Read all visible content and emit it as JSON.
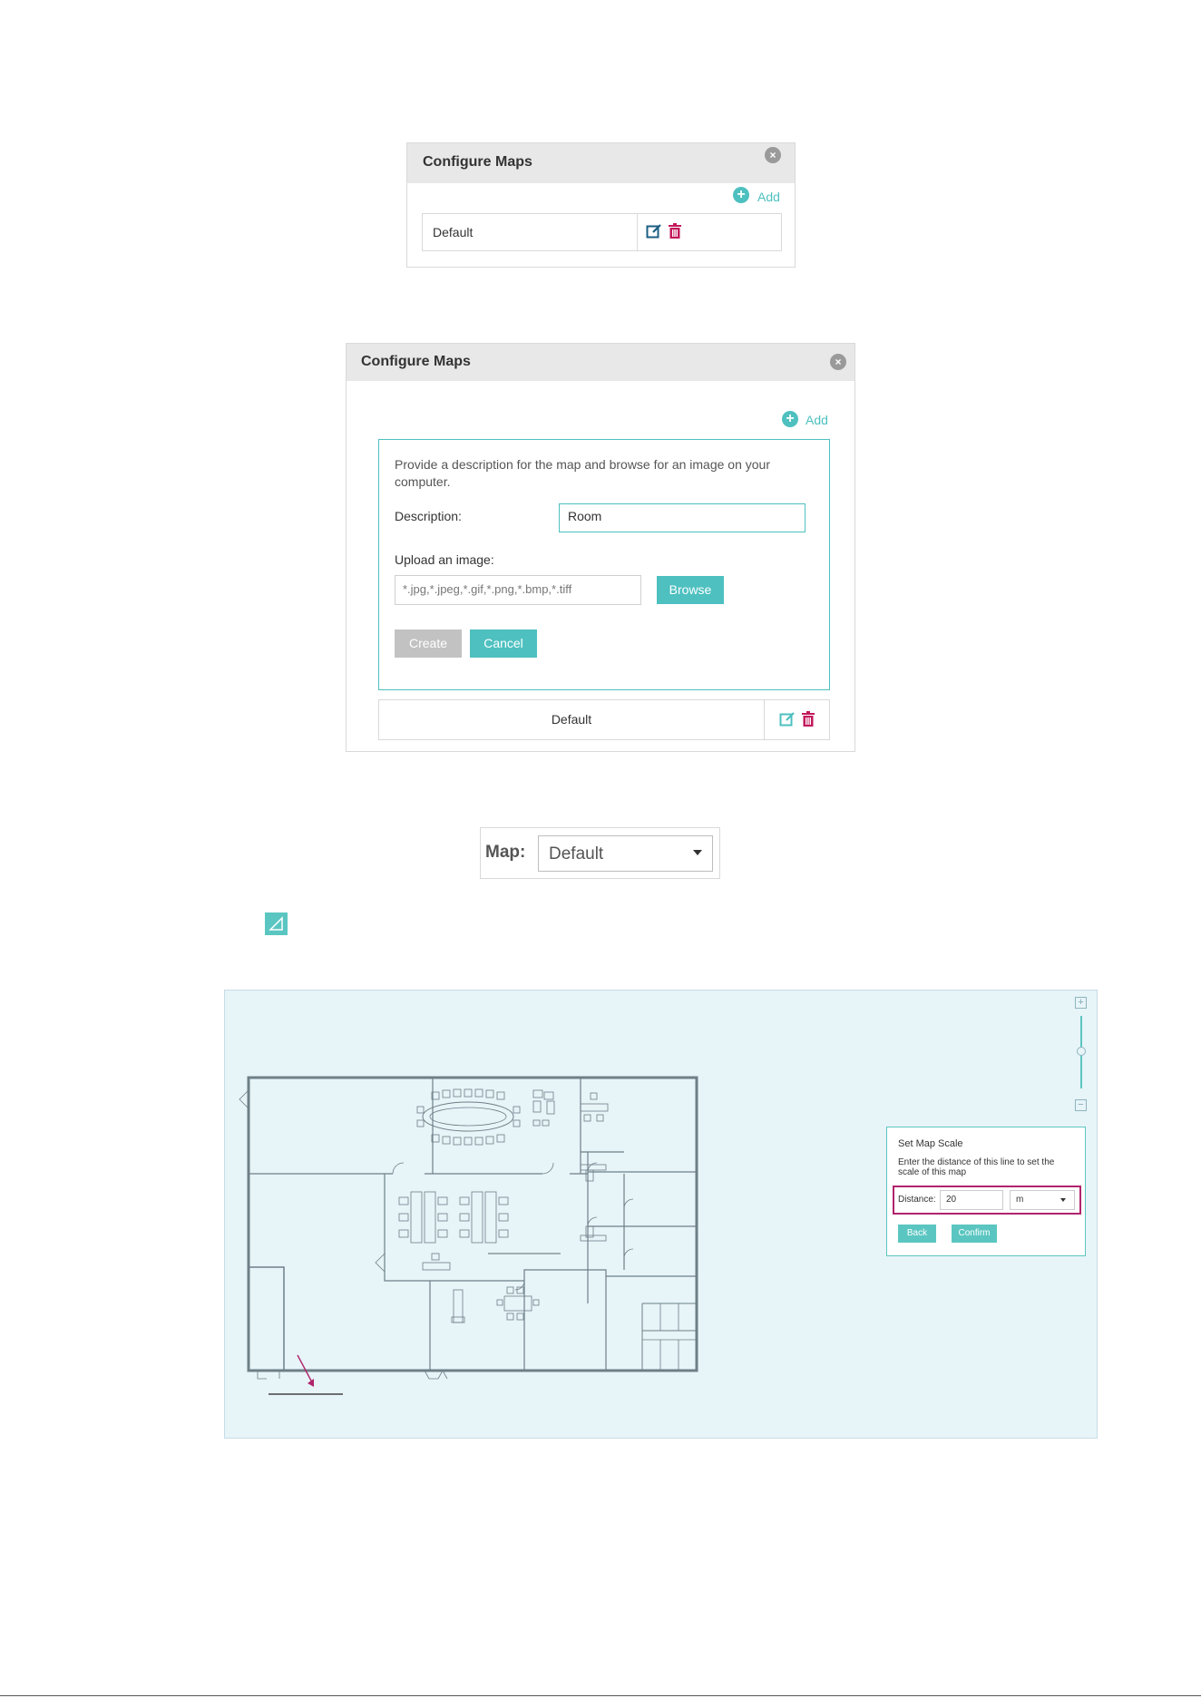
{
  "dialog1": {
    "title": "Configure Maps",
    "add_label": "Add",
    "rows": [
      {
        "name": "Default"
      }
    ]
  },
  "dialog2": {
    "title": "Configure Maps",
    "add_label": "Add",
    "form": {
      "instructions": "Provide a description for the map and browse for an image on your computer.",
      "description_label": "Description:",
      "description_value": "Room",
      "upload_label": "Upload an image:",
      "file_placeholder": "*.jpg,*.jpeg,*.gif,*.png,*.bmp,*.tiff",
      "browse_label": "Browse",
      "create_label": "Create",
      "cancel_label": "Cancel"
    },
    "rows": [
      {
        "name": "Default"
      }
    ]
  },
  "map_selector": {
    "label": "Map:",
    "selected": "Default"
  },
  "map_view": {
    "zoom_in": "+",
    "zoom_out": "−",
    "scale_panel": {
      "title": "Set Map Scale",
      "description": "Enter the distance of this line to set the scale of this map",
      "distance_label": "Distance:",
      "distance_value": "20",
      "unit": "m",
      "back_label": "Back",
      "confirm_label": "Confirm"
    }
  },
  "colors": {
    "accent": "#4ec0c0",
    "delete": "#c2185b",
    "highlight": "#b0246c",
    "canvas_bg": "#e7f4f8"
  }
}
